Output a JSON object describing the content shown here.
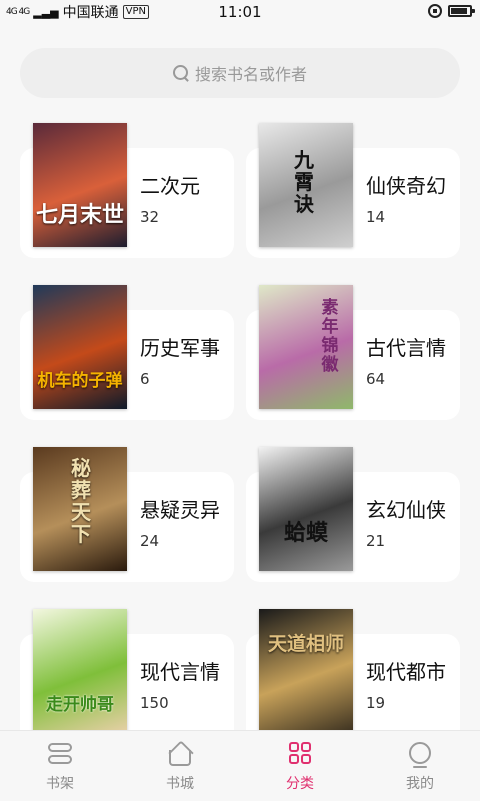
{
  "status_bar": {
    "signal": "4G 4G",
    "carrier": "中国联通",
    "vpn": "VPN",
    "time": "11:01",
    "battery_level": 0.9
  },
  "search": {
    "placeholder": "搜索书名或作者"
  },
  "categories": [
    {
      "name": "二次元",
      "count": "32",
      "cover_text": "七月末世",
      "cover_colors": [
        "#5a2a3a",
        "#d9603a",
        "#1d1d2f"
      ]
    },
    {
      "name": "仙侠奇幻",
      "count": "14",
      "cover_text": "九霄诀",
      "cover_colors": [
        "#e8e8e8",
        "#9a9a9a",
        "#cfcfcf"
      ]
    },
    {
      "name": "历史军事",
      "count": "6",
      "cover_text": "机车的子弹",
      "cover_colors": [
        "#203a5a",
        "#c44a1a",
        "#0e1a2a"
      ]
    },
    {
      "name": "古代言情",
      "count": "64",
      "cover_text": "素年锦徽",
      "cover_colors": [
        "#dfe8c8",
        "#b96ba8",
        "#8fb86a"
      ]
    },
    {
      "name": "悬疑灵异",
      "count": "24",
      "cover_text": "秘葬天下",
      "cover_colors": [
        "#5a3a1f",
        "#b58f5a",
        "#2a1a0d"
      ]
    },
    {
      "name": "玄幻仙侠",
      "count": "21",
      "cover_text": "蛤蟆",
      "cover_colors": [
        "#f2f2f2",
        "#3a3a3a",
        "#9a9a9a"
      ]
    },
    {
      "name": "现代言情",
      "count": "150",
      "cover_text": "走开帅哥",
      "cover_colors": [
        "#f3f7e0",
        "#7fbf3a",
        "#e8d0a8"
      ]
    },
    {
      "name": "现代都市",
      "count": "19",
      "cover_text": "天道相师",
      "cover_colors": [
        "#1a1a1a",
        "#c8a25a",
        "#3a3020"
      ]
    }
  ],
  "bottom_nav": {
    "items": [
      {
        "label": "书架",
        "icon": "bookshelf-icon"
      },
      {
        "label": "书城",
        "icon": "bookstore-icon"
      },
      {
        "label": "分类",
        "icon": "category-icon"
      },
      {
        "label": "我的",
        "icon": "profile-icon"
      }
    ],
    "active": "分类",
    "active_color": "#e0306f"
  }
}
